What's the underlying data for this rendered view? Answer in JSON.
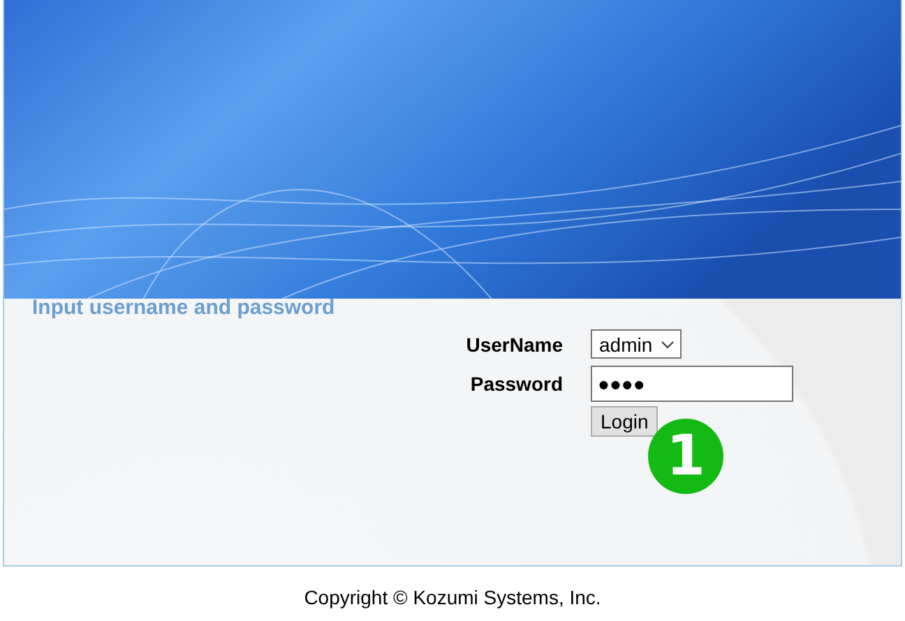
{
  "heading": "Input username and password",
  "form": {
    "username_label": "UserName",
    "username_value": "admin",
    "password_label": "Password",
    "password_value": "●●●●",
    "login_button": "Login"
  },
  "step_badge": "1",
  "footer": "Copyright © Kozumi Systems, Inc."
}
